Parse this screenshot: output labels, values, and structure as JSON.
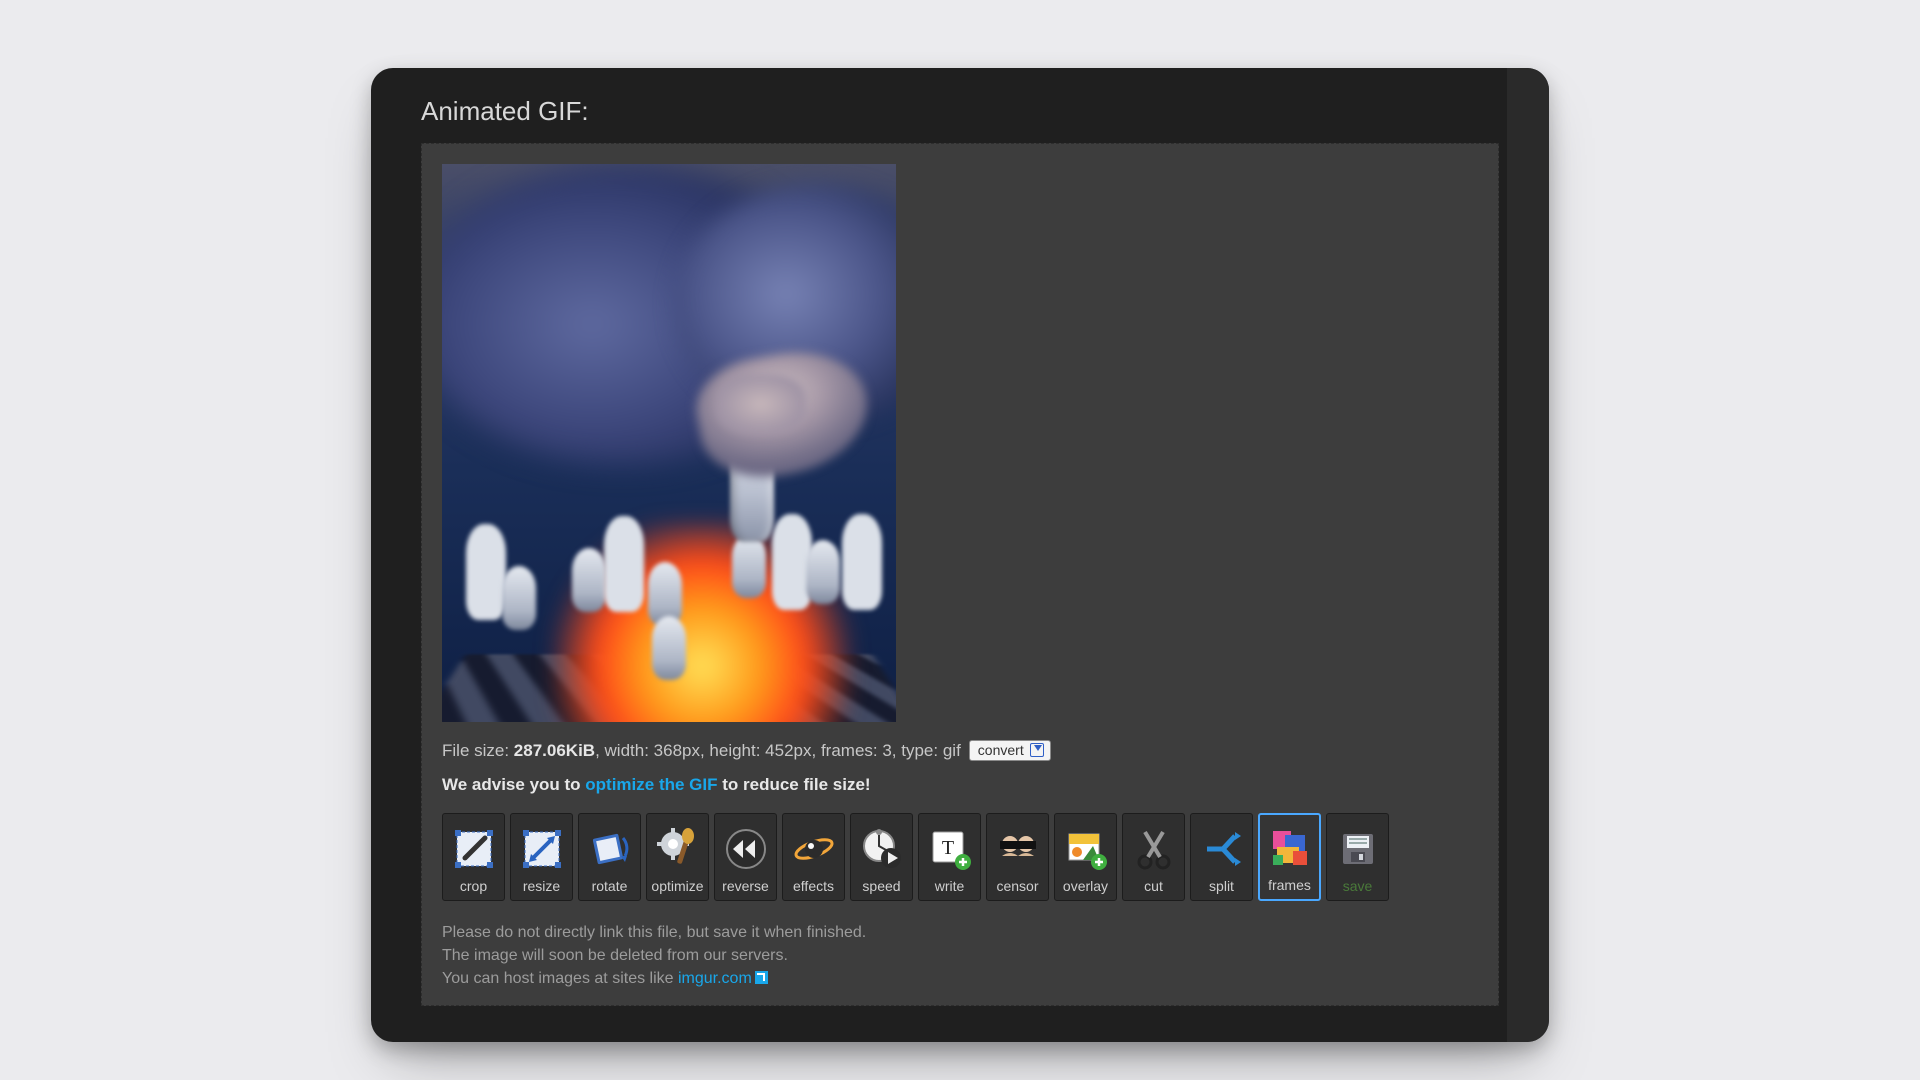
{
  "title": "Animated GIF:",
  "info": {
    "size_label": "File size: ",
    "size_value": "287.06KiB",
    "rest": ", width: 368px, height: 452px, frames: 3, type: gif",
    "convert_label": "convert"
  },
  "advise": {
    "prefix": "We advise you to ",
    "link": "optimize the GIF",
    "suffix": " to reduce file size!"
  },
  "tools": [
    {
      "id": "crop",
      "label": "crop"
    },
    {
      "id": "resize",
      "label": "resize"
    },
    {
      "id": "rotate",
      "label": "rotate"
    },
    {
      "id": "optimize",
      "label": "optimize"
    },
    {
      "id": "reverse",
      "label": "reverse"
    },
    {
      "id": "effects",
      "label": "effects"
    },
    {
      "id": "speed",
      "label": "speed"
    },
    {
      "id": "write",
      "label": "write"
    },
    {
      "id": "censor",
      "label": "censor"
    },
    {
      "id": "overlay",
      "label": "overlay"
    },
    {
      "id": "cut",
      "label": "cut"
    },
    {
      "id": "split",
      "label": "split"
    },
    {
      "id": "frames",
      "label": "frames",
      "active": true
    },
    {
      "id": "save",
      "label": "save"
    }
  ],
  "notes": {
    "l1": "Please do not directly link this file, but save it when finished.",
    "l2": "The image will soon be deleted from our servers.",
    "l3_prefix": "You can host images at sites like ",
    "l3_link": "imgur.com"
  }
}
